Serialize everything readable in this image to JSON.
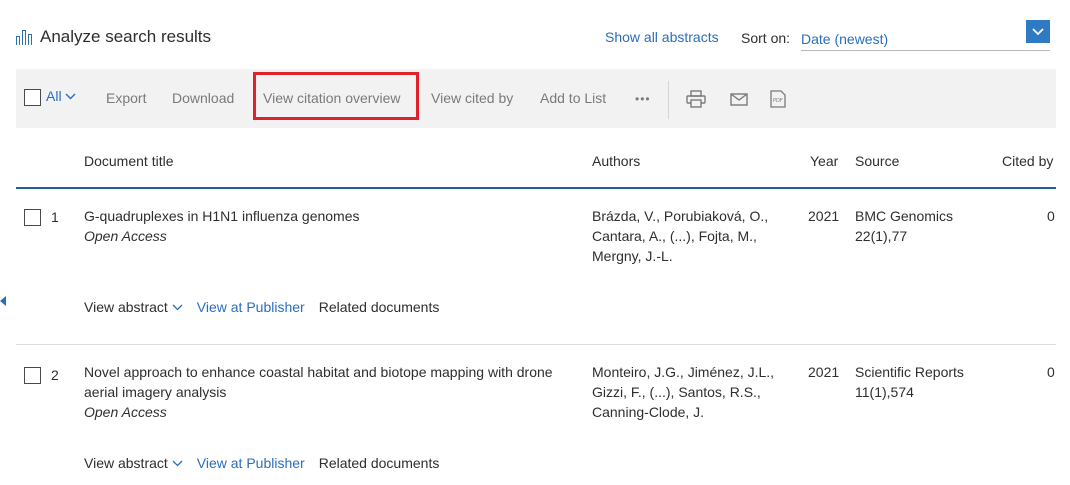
{
  "header": {
    "title": "Analyze search results",
    "show_all_abstracts": "Show all abstracts",
    "sort_label": "Sort on:",
    "sort_value": "Date (newest)"
  },
  "toolbar": {
    "all_label": "All",
    "export": "Export",
    "download": "Download",
    "view_citation_overview": "View citation overview",
    "view_cited_by": "View cited by",
    "add_to_list": "Add to List",
    "more": "•••",
    "icons": [
      "print-icon",
      "email-icon",
      "pdf-icon"
    ]
  },
  "table": {
    "headers": {
      "title": "Document title",
      "authors": "Authors",
      "year": "Year",
      "source": "Source",
      "cited_by": "Cited by"
    },
    "rows": [
      {
        "num": "1",
        "title": "G-quadruplexes in H1N1 influenza genomes",
        "access": "Open Access",
        "authors": "Brázda, V., Porubiaková, O., Cantara, A., (...), Fojta, M., Mergny, J.-L.",
        "year": "2021",
        "source": "BMC Genomics",
        "source_detail": "22(1),77",
        "cited": "0",
        "view_abstract": "View abstract",
        "view_publisher": "View at Publisher",
        "related": "Related documents"
      },
      {
        "num": "2",
        "title": "Novel approach to enhance coastal habitat and biotope mapping with drone aerial imagery analysis",
        "access": "Open Access",
        "authors": "Monteiro, J.G., Jiménez, J.L., Gizzi, F., (...), Santos, R.S., Canning-Clode, J.",
        "year": "2021",
        "source": "Scientific Reports",
        "source_detail": "11(1),574",
        "cited": "0",
        "view_abstract": "View abstract",
        "view_publisher": "View at Publisher",
        "related": "Related documents"
      }
    ]
  },
  "colors": {
    "accent": "#2a6ebb",
    "highlight_box": "#e0202a",
    "toolbar_bg": "#f2f2f2",
    "header_rule": "#1f5e99"
  }
}
